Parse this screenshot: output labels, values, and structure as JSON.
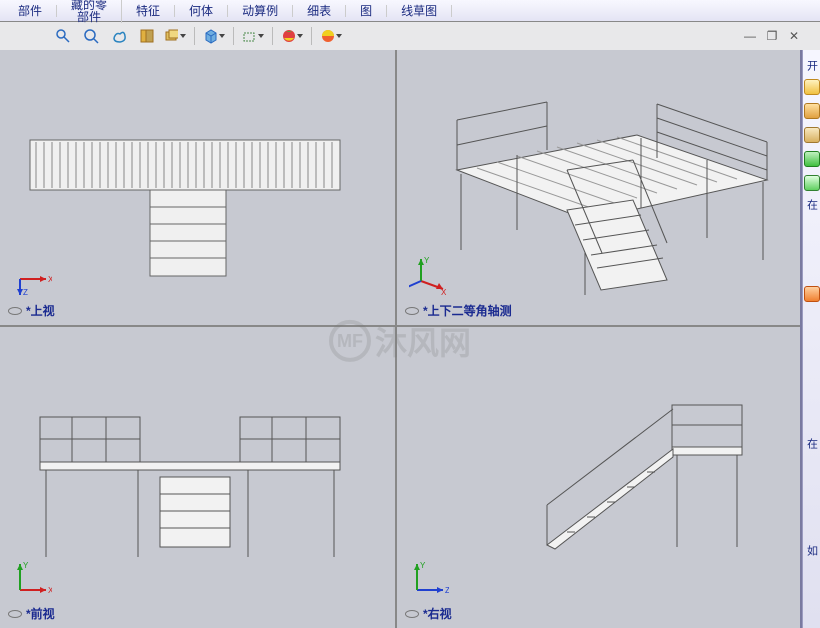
{
  "ribbon": {
    "items": [
      "部件",
      "藏的零\n部件",
      "特征",
      "何体",
      "动算例",
      "细表",
      "图",
      "线草图"
    ]
  },
  "toolbar": {
    "tools": [
      {
        "name": "zoom-window-icon"
      },
      {
        "name": "zoom-icon"
      },
      {
        "name": "pan-icon"
      },
      {
        "name": "sectioned-view-icon"
      },
      {
        "name": "display-style-icon",
        "drop": true
      },
      {
        "name": "sep"
      },
      {
        "name": "box-icon",
        "drop": true
      },
      {
        "name": "sep"
      },
      {
        "name": "hide-icon",
        "drop": true
      },
      {
        "name": "sep"
      },
      {
        "name": "appearance-sphere-icon",
        "drop": true
      },
      {
        "name": "sep"
      },
      {
        "name": "scene-sphere-icon",
        "drop": true
      }
    ]
  },
  "winctrls": {
    "min": "—",
    "restore": "❐",
    "close": "✕"
  },
  "views": {
    "tl": {
      "label": "*上视",
      "axes": [
        "X",
        "Z"
      ]
    },
    "tr": {
      "label": "*上下二等角轴测",
      "axes": [
        "X",
        "Y",
        "Z"
      ]
    },
    "bl": {
      "label": "*前视",
      "axes": [
        "X",
        "Y"
      ]
    },
    "br": {
      "label": "*右视",
      "axes": [
        "Z",
        "Y"
      ]
    }
  },
  "watermark": {
    "logo": "MF",
    "text": "沐风网"
  },
  "taskpane": {
    "sections": [
      "开",
      "在",
      "在",
      "如"
    ],
    "icons": [
      "home",
      "wiz",
      "folder",
      "green",
      "plus",
      "rss"
    ]
  }
}
